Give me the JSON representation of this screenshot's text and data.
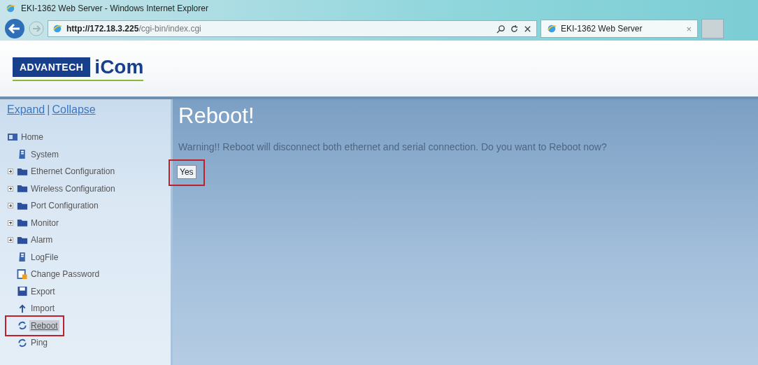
{
  "window": {
    "title": "EKI-1362 Web Server - Windows Internet Explorer"
  },
  "address_bar": {
    "host": "http://172.18.3.225",
    "path": "/cgi-bin/index.cgi"
  },
  "browser_tab": {
    "label": "EKI-1362 Web Server",
    "close": "×"
  },
  "logo": {
    "brand": "ADVANTECH",
    "product": "iCom"
  },
  "sidebar": {
    "links": [
      "Expand",
      "Collapse"
    ],
    "separator": "|",
    "tree": {
      "label": "Home",
      "children": [
        {
          "label": "System",
          "kind": "page",
          "expandable": false,
          "selected": false,
          "highlighted": false
        },
        {
          "label": "Ethernet Configuration",
          "kind": "folder",
          "expandable": true,
          "selected": false,
          "highlighted": false
        },
        {
          "label": "Wireless Configuration",
          "kind": "folder",
          "expandable": true,
          "selected": false,
          "highlighted": false
        },
        {
          "label": "Port Configuration",
          "kind": "folder",
          "expandable": true,
          "selected": false,
          "highlighted": false
        },
        {
          "label": "Monitor",
          "kind": "folder",
          "expandable": true,
          "selected": false,
          "highlighted": false
        },
        {
          "label": "Alarm",
          "kind": "folder",
          "expandable": true,
          "selected": false,
          "highlighted": false
        },
        {
          "label": "LogFile",
          "kind": "page",
          "expandable": false,
          "selected": false,
          "highlighted": false
        },
        {
          "label": "Change Password",
          "kind": "key",
          "expandable": false,
          "selected": false,
          "highlighted": false
        },
        {
          "label": "Export",
          "kind": "disk",
          "expandable": false,
          "selected": false,
          "highlighted": false
        },
        {
          "label": "Import",
          "kind": "import",
          "expandable": false,
          "selected": false,
          "highlighted": false
        },
        {
          "label": "Reboot",
          "kind": "cycle",
          "expandable": false,
          "selected": true,
          "highlighted": true
        },
        {
          "label": "Ping",
          "kind": "cycle",
          "expandable": false,
          "selected": false,
          "highlighted": false
        }
      ]
    }
  },
  "main": {
    "heading": "Reboot!",
    "warning": "Warning!! Reboot will disconnect both ethernet and serial connection. Do you want to Reboot now?",
    "button": {
      "label": "Yes",
      "highlighted": true
    }
  }
}
